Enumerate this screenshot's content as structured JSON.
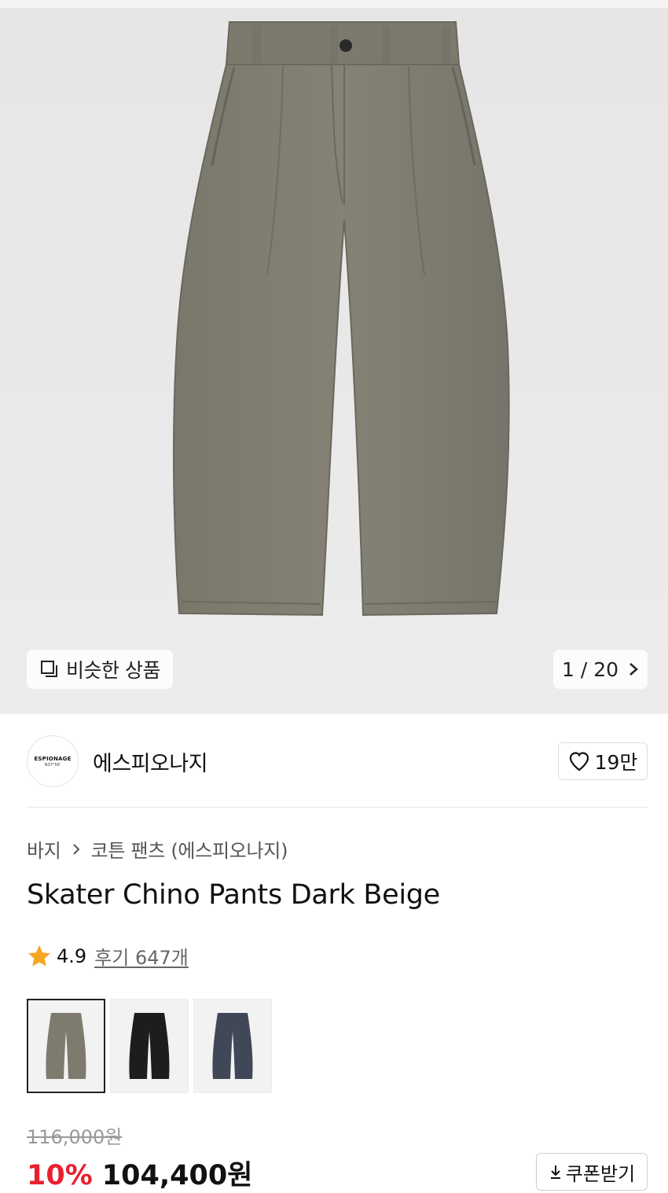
{
  "gallery": {
    "similar_label": "비슷한 상품",
    "counter": "1 / 20"
  },
  "brand": {
    "logo_line1": "ESPIONAGE",
    "logo_line2": "N37°56'",
    "name": "에스피오나지",
    "likes": "19만"
  },
  "breadcrumb": {
    "category": "바지",
    "subcategory": "코튼 팬츠 (에스피오나지)"
  },
  "product": {
    "title": "Skater Chino Pants Dark Beige",
    "rating": "4.9",
    "reviews": "후기 647개"
  },
  "swatches": [
    {
      "color": "#7e7b6e",
      "selected": true
    },
    {
      "color": "#1d1d1d",
      "selected": false
    },
    {
      "color": "#404858",
      "selected": false
    }
  ],
  "pricing": {
    "original": "116,000원",
    "discount": "10%",
    "price": "104,400원",
    "coupon_label": "쿠폰받기"
  },
  "colors": {
    "accent_red": "#e8202f",
    "star": "#f5a623",
    "pants": "#807d70"
  }
}
